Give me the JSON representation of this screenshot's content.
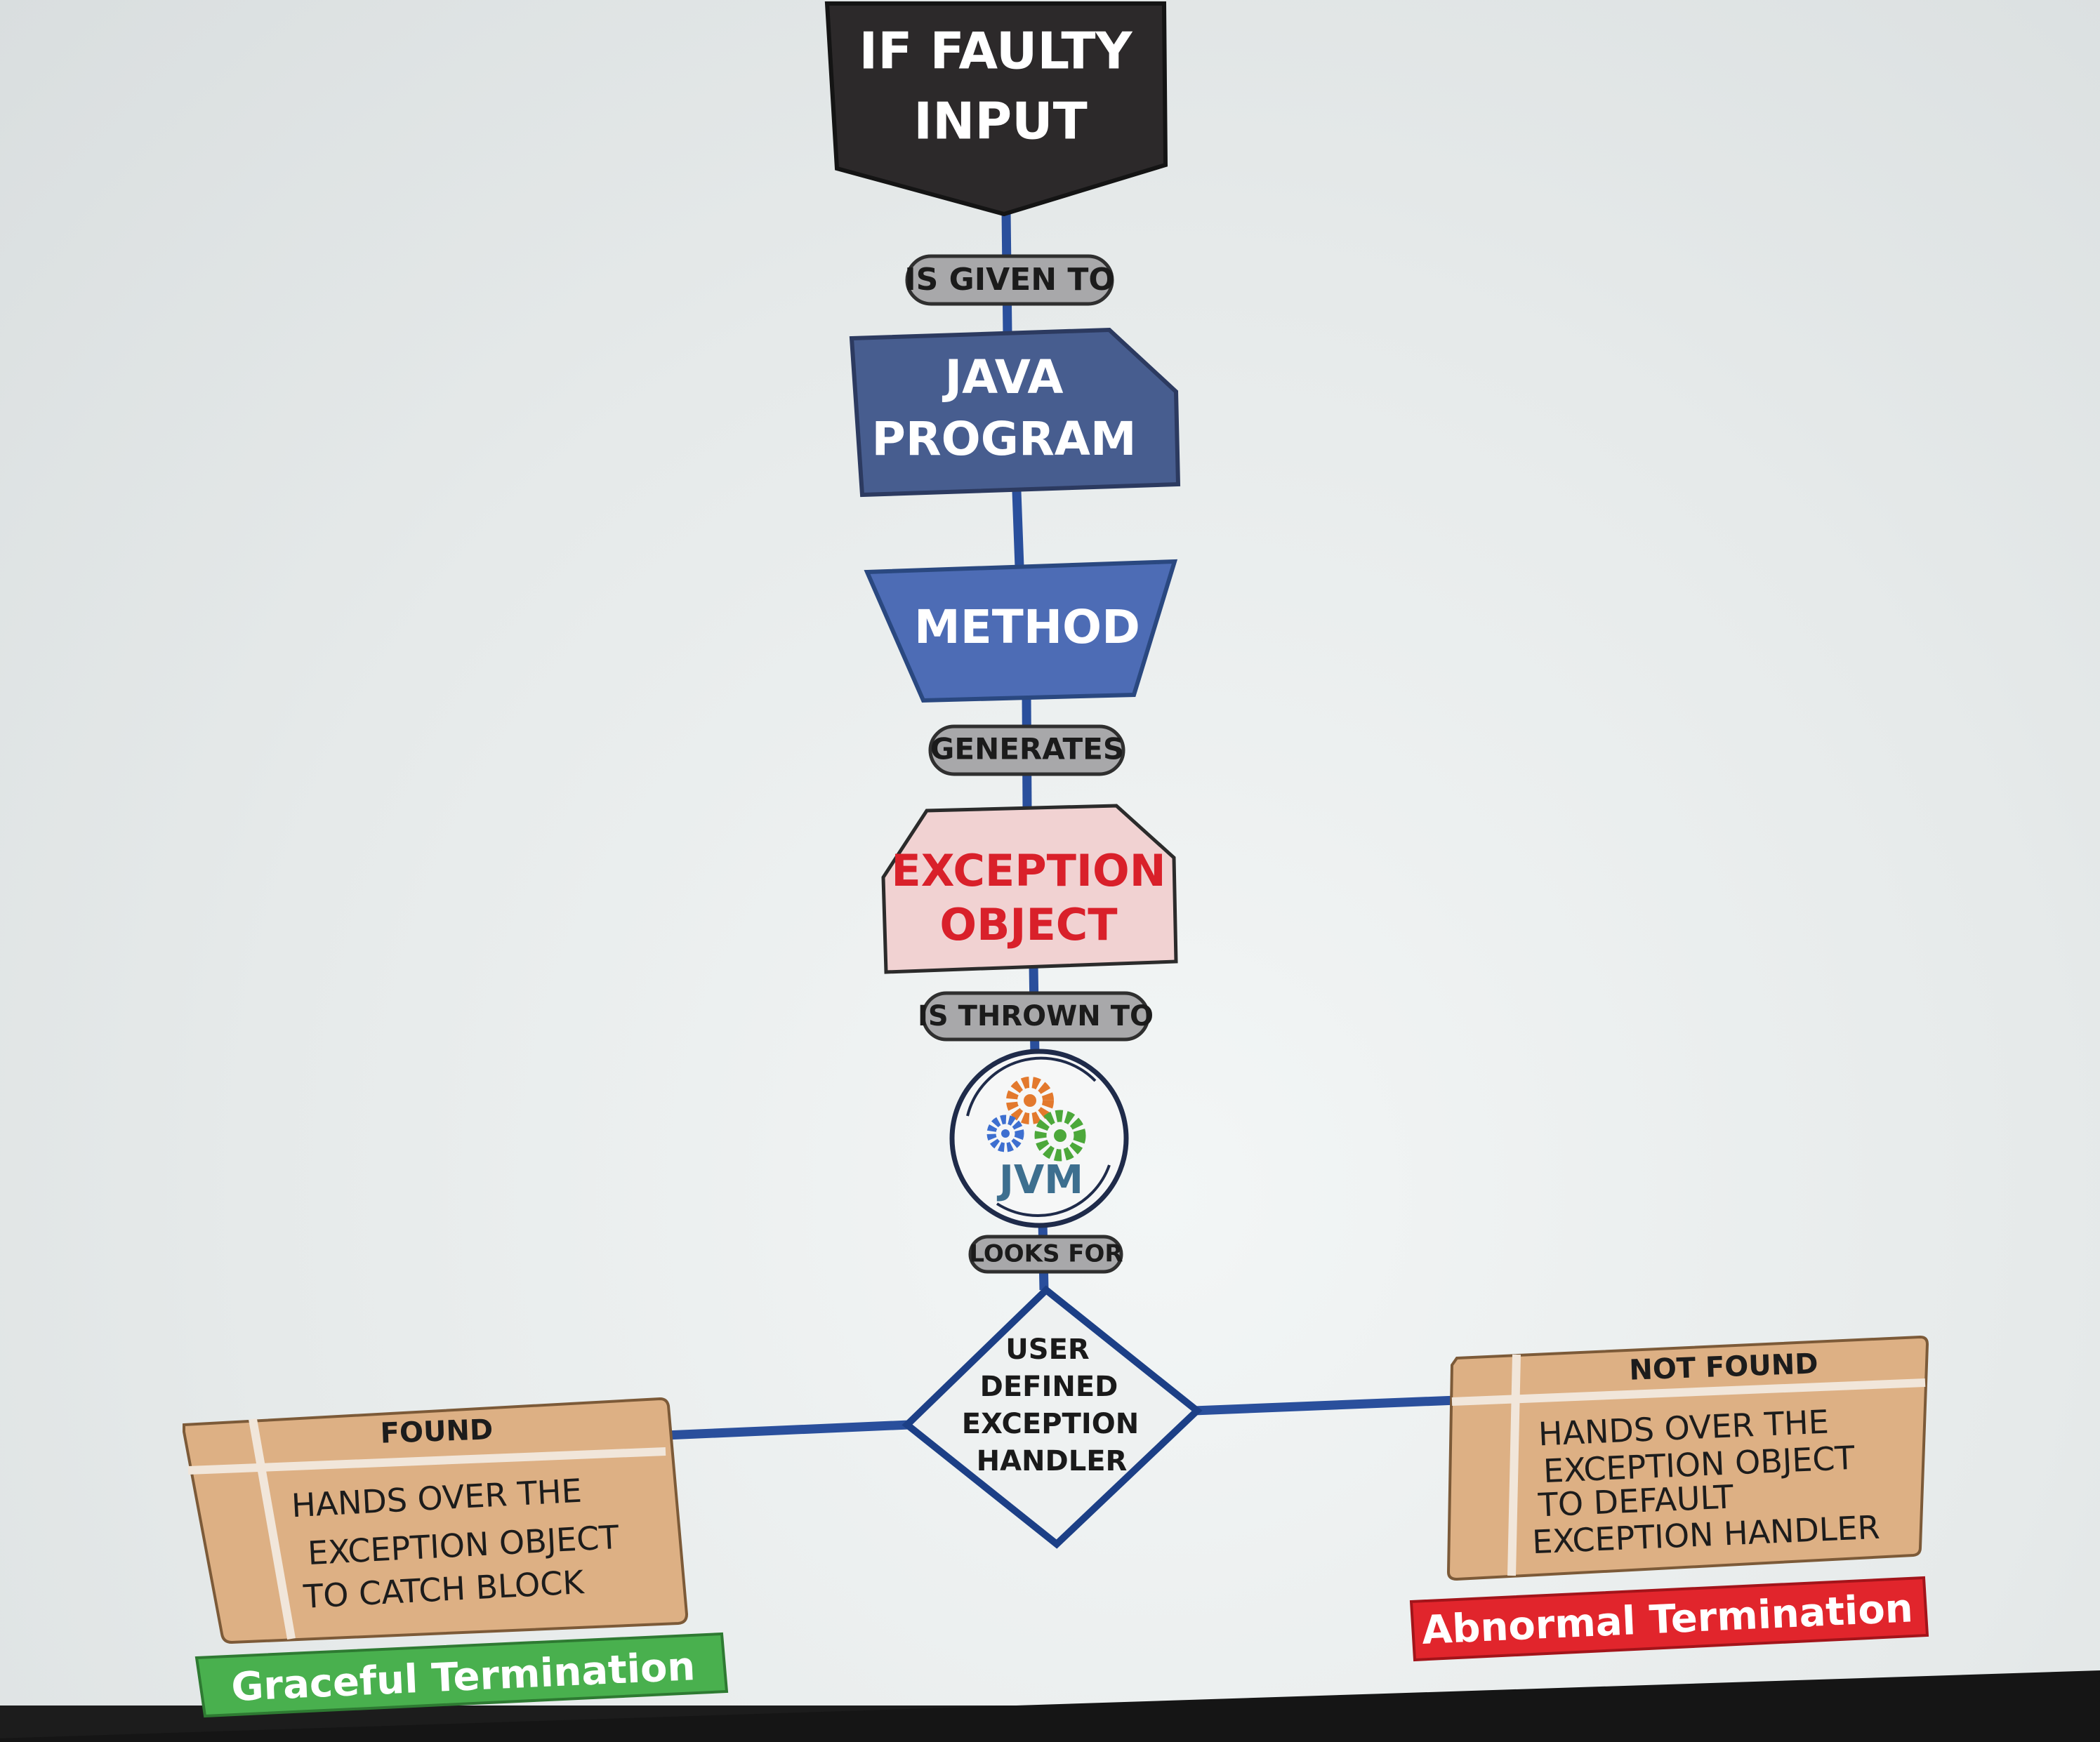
{
  "nodes": {
    "start": {
      "line1": "IF FAULTY",
      "line2": "INPUT"
    },
    "program": {
      "line1": "JAVA",
      "line2": "PROGRAM"
    },
    "method": {
      "label": "METHOD"
    },
    "exception": {
      "line1": "EXCEPTION",
      "line2": "OBJECT"
    },
    "jvm": {
      "label": "JVM",
      "icon": "gears-icon"
    },
    "decision": {
      "line1": "USER",
      "line2": "DEFINED",
      "line3": "EXCEPTION",
      "line4": "HANDLER"
    }
  },
  "edges": {
    "given": "IS GIVEN TO",
    "generates": "GENERATES",
    "thrown": "IS THROWN TO",
    "looks": "LOOKS FOR"
  },
  "branches": {
    "found": {
      "header": "FOUND",
      "line1": "HANDS OVER THE",
      "line2": "EXCEPTION OBJECT",
      "line3": "TO CATCH BLOCK",
      "result": "Graceful Termination"
    },
    "not_found": {
      "header": "NOT FOUND",
      "line1": "HANDS OVER THE",
      "line2": "EXCEPTION OBJECT",
      "line3": "TO DEFAULT",
      "line4": "EXCEPTION HANDLER",
      "result": "Abnormal Termination"
    }
  },
  "colors": {
    "connector": "#2a4f9c",
    "start_fill": "#2c292a",
    "program_fill": "#475d8f",
    "method_fill": "#4d6cb5",
    "exception_fill": "#f1d2d2",
    "exception_text": "#d9202a",
    "pill_fill": "#a8a8aa",
    "decision_stroke": "#1c3f86",
    "card_fill": "#ddb084",
    "graceful": "#49b04e",
    "abnormal": "#e1252c"
  }
}
